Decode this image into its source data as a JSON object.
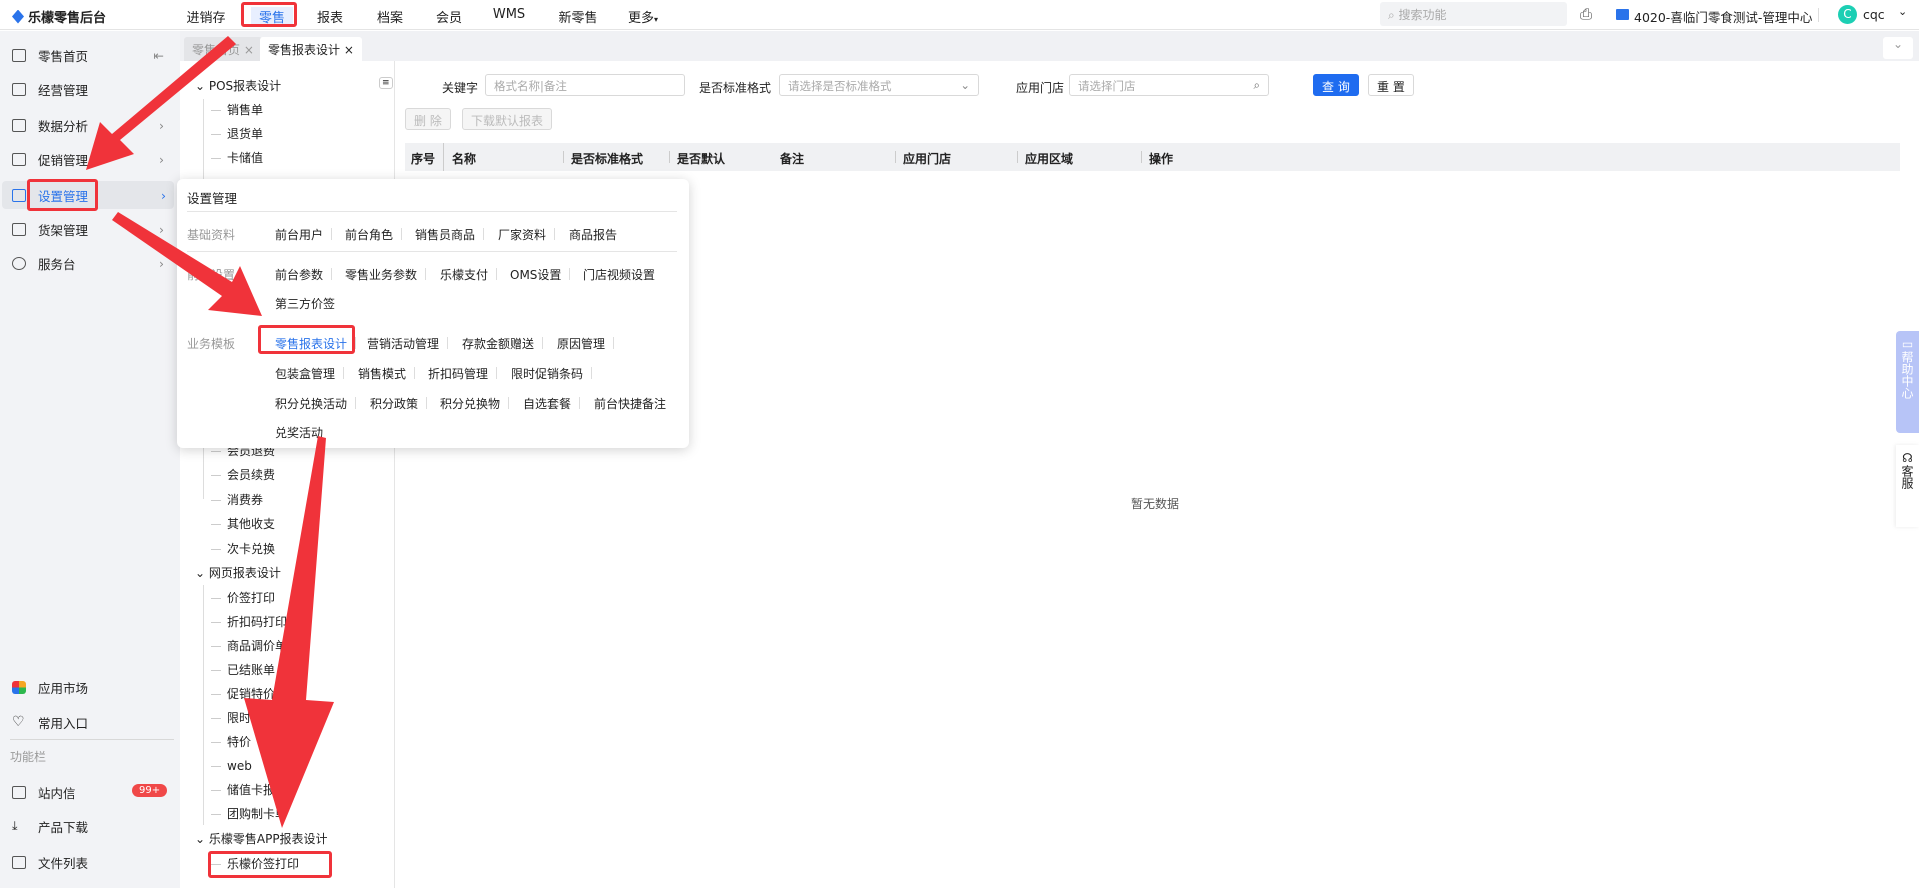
{
  "app": {
    "title": "乐檬零售后台"
  },
  "topnav": [
    "进销存",
    "零售",
    "报表",
    "档案",
    "会员",
    "WMS",
    "新零售",
    "更多"
  ],
  "header": {
    "search_placeholder": "搜索功能",
    "store": "4020-喜临门零食测试-管理中心",
    "avatar_letter": "C",
    "user": "cqc"
  },
  "tabs": [
    {
      "label": "零售首页"
    },
    {
      "label": "零售报表设计"
    }
  ],
  "sidebar": {
    "items": [
      "零售首页",
      "经营管理",
      "数据分析",
      "促销管理",
      "设置管理",
      "货架管理",
      "服务台"
    ],
    "bottom": [
      "应用市场",
      "常用入口"
    ],
    "section": "功能栏",
    "tools": [
      "站内信",
      "产品下载",
      "文件列表"
    ],
    "badge": "99+"
  },
  "tree": {
    "group1": "POS报表设计",
    "group1_items": [
      "销售单",
      "退货单",
      "卡储值"
    ],
    "group1_more": [
      "会员退费",
      "会员续费",
      "消费券",
      "其他收支",
      "次卡兑换"
    ],
    "group2": "网页报表设计",
    "group2_items": [
      "价签打印",
      "折扣码打印",
      "商品调价单",
      "已结账单",
      "促销特价",
      "限时促销",
      "特价",
      "web",
      "储值卡报表",
      "团购制卡单"
    ],
    "group3": "乐檬零售APP报表设计",
    "group3_items": [
      "乐檬价签打印"
    ]
  },
  "filters": {
    "keyword_label": "关键字",
    "keyword_placeholder": "格式名称|备注",
    "std_label": "是否标准格式",
    "std_placeholder": "请选择是否标准格式",
    "store_label": "应用门店",
    "store_placeholder": "请选择门店",
    "query": "查 询",
    "reset": "重 置",
    "delete": "删 除",
    "download": "下载默认报表"
  },
  "table": {
    "columns": [
      "序号",
      "名称",
      "是否标准格式",
      "是否默认",
      "备注",
      "应用门店",
      "应用区域",
      "操作"
    ],
    "empty": "暂无数据"
  },
  "popup": {
    "title": "设置管理",
    "groups": [
      {
        "label": "基础资料",
        "items": [
          "前台用户",
          "前台角色",
          "销售员商品",
          "厂家资料",
          "商品报告"
        ]
      },
      {
        "label": "前台设置",
        "items": [
          "前台参数",
          "零售业务参数",
          "乐檬支付",
          "OMS设置",
          "门店视频设置",
          "第三方价签"
        ]
      },
      {
        "label": "业务模板",
        "items": [
          "零售报表设计",
          "营销活动管理",
          "存款金额赠送",
          "原因管理",
          "包装盒管理",
          "销售模式",
          "折扣码管理",
          "限时促销条码",
          "积分兑换活动",
          "积分政策",
          "积分兑换物",
          "自选套餐",
          "前台快捷备注",
          "兑奖活动"
        ]
      }
    ]
  },
  "float": {
    "help": "帮助中心",
    "service": "客服"
  },
  "colors": {
    "accent": "#1f6cf0",
    "annotation": "#f0333a"
  }
}
